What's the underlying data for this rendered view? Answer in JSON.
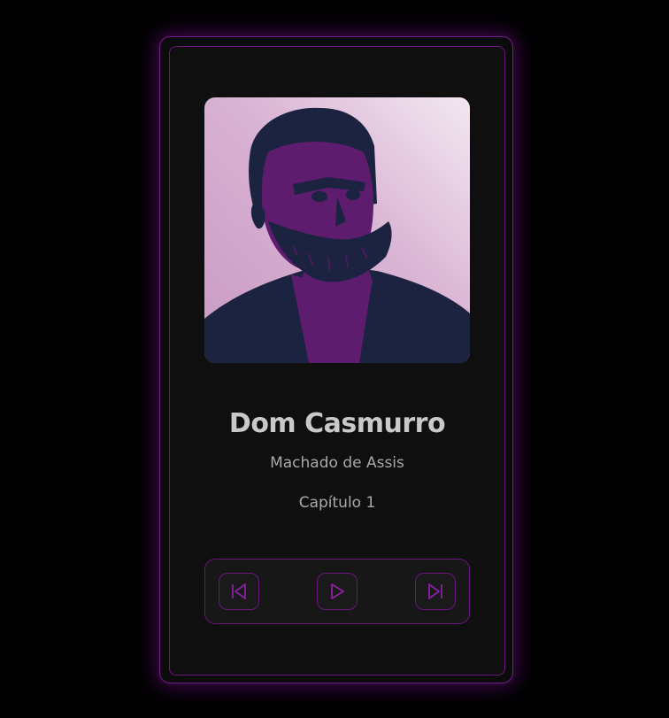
{
  "book": {
    "title": "Dom Casmurro",
    "author": "Machado de Assis",
    "chapter": "Capítulo 1"
  },
  "icons": {
    "previous": "skip-back-icon",
    "play": "play-icon",
    "next": "skip-forward-icon"
  },
  "colors": {
    "accent": "#7a1a8f",
    "background": "#000000",
    "card": "#0f0f0f",
    "text_primary": "#c9c9c9",
    "text_secondary": "#a9a9a9"
  }
}
